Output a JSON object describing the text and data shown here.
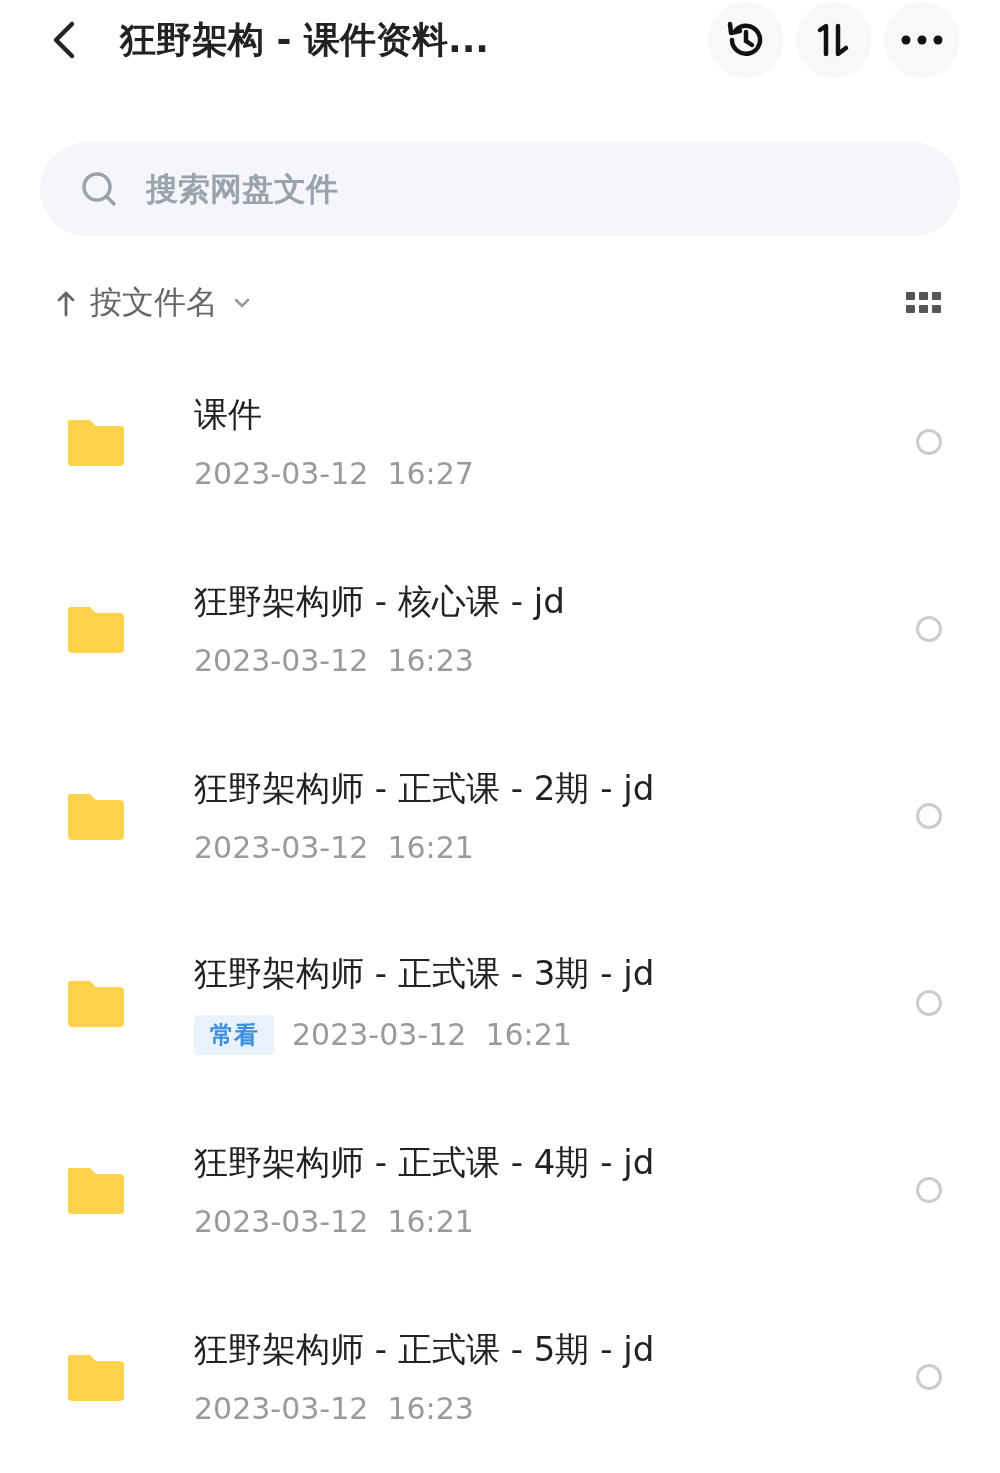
{
  "header": {
    "title": "狂野架构 - 课件资料..."
  },
  "search": {
    "placeholder": "搜索网盘文件"
  },
  "sort": {
    "label": "按文件名"
  },
  "files": [
    {
      "name": "课件",
      "date": "2023-03-12  16:27",
      "selected": false
    },
    {
      "name": "狂野架构师 - 核心课 - jd",
      "date": "2023-03-12  16:23",
      "selected": false
    },
    {
      "name": "狂野架构师 - 正式课 - 2期 - jd",
      "date": "2023-03-12  16:21",
      "selected": false
    },
    {
      "name": "狂野架构师 - 正式课 - 3期 - jd",
      "tag": "常看",
      "date": "2023-03-12  16:21",
      "selected": false
    },
    {
      "name": "狂野架构师 - 正式课 - 4期 - jd",
      "date": "2023-03-12  16:21",
      "selected": false
    },
    {
      "name": "狂野架构师 - 正式课 - 5期 - jd",
      "date": "2023-03-12  16:23",
      "selected": false
    }
  ]
}
